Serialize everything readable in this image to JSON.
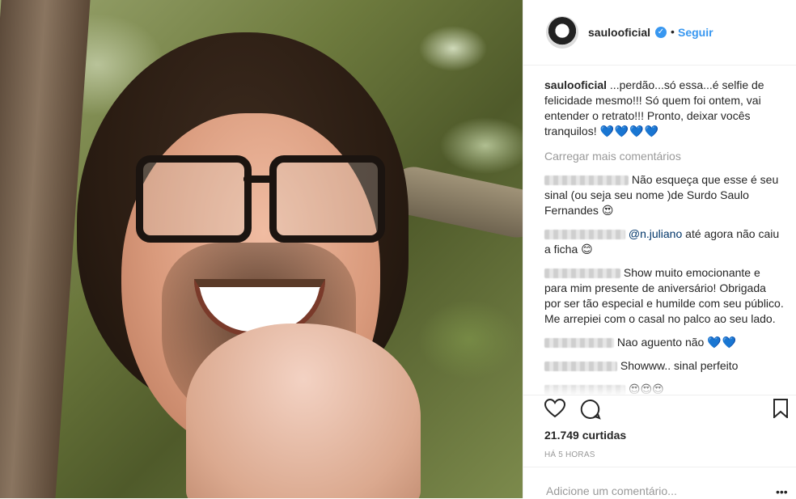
{
  "post": {
    "username": "saulooficial",
    "follow_label": "Seguir",
    "separator": "•",
    "verified_glyph": "✓",
    "caption": "...perdão...só essa...é selfie de felicidade mesmo!!! Só quem foi ontem, vai entender o retrato!!! Pronto, deixar vocês tranquilos!",
    "caption_emoji": "💙💙💙💙",
    "load_more": "Carregar mais comentários",
    "comments": [
      {
        "text": "Não esqueça que esse é seu sinal (ou seja seu nome )de Surdo Saulo Fernandes",
        "emoji": "😍"
      },
      {
        "mention": "@n.juliano",
        "text": "até agora não caiu a ficha",
        "emoji": "😊"
      },
      {
        "text": "Show muito emocionante e para mim presente de aniversário! Obrigada por ser tão especial e humilde com seu público. Me arrepiei com o casal no palco ao seu lado.",
        "emoji": ""
      },
      {
        "text": "Nao aguento não",
        "emoji": "💙💙"
      },
      {
        "text": "Showww.. sinal perfeito",
        "emoji": ""
      },
      {
        "text": "",
        "emoji": "😍😍😍"
      }
    ],
    "likes": "21.749 curtidas",
    "time": "HÁ 5 HORAS",
    "add_comment_placeholder": "Adicione um comentário...",
    "more_glyph": "•••"
  },
  "icons": {
    "like": "heart-icon",
    "comment": "comment-icon",
    "save": "bookmark-icon",
    "more": "more-options-icon"
  },
  "colors": {
    "link_blue": "#3897f0",
    "mention_blue": "#003569",
    "muted": "#999999",
    "text": "#262626",
    "heart_emoji": "#29b6e8"
  }
}
